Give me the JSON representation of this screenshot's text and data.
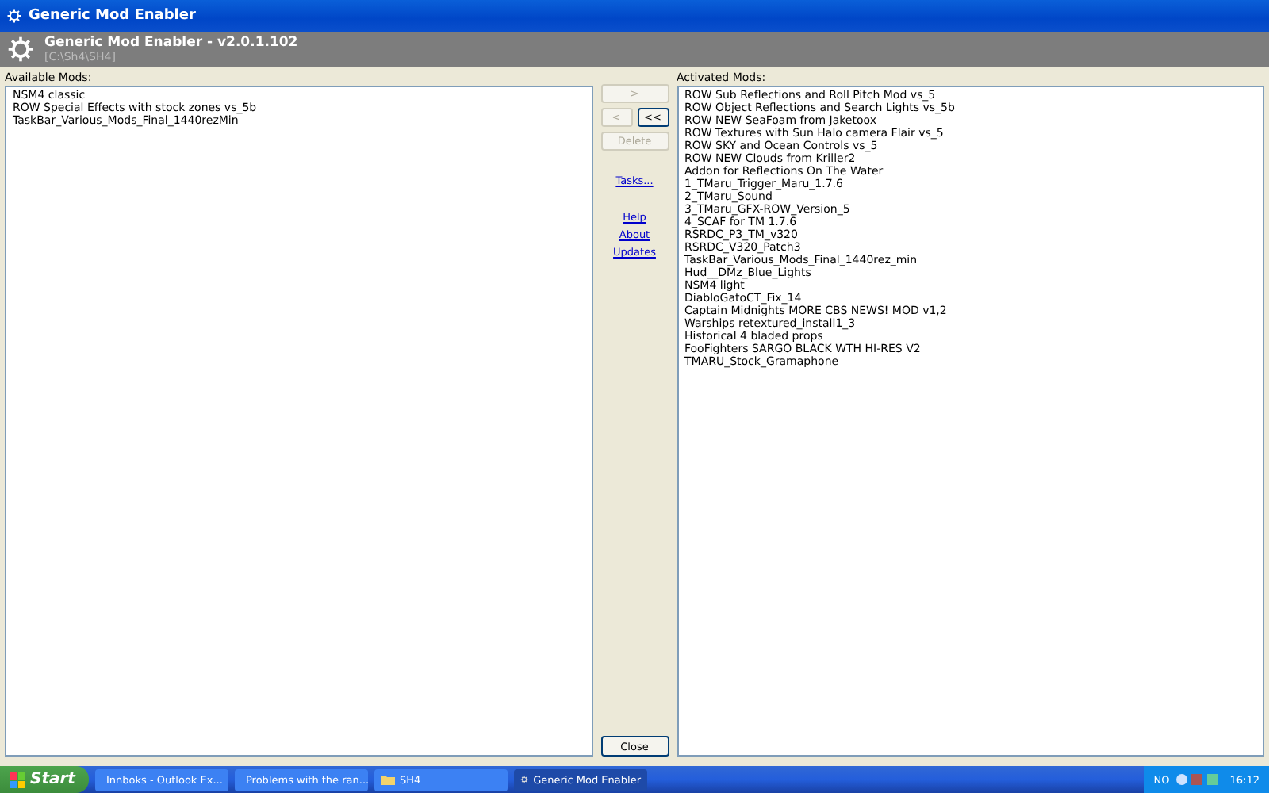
{
  "window": {
    "title": "Generic Mod Enabler"
  },
  "header": {
    "title": "Generic Mod Enabler - v2.0.1.102",
    "path": "[C:\\Sh4\\SH4]"
  },
  "available": {
    "label": "Available Mods:",
    "items": [
      {
        "text": "NSM4 classic",
        "selected": false
      },
      {
        "text": "ROW Special Effects with stock zones vs_5b",
        "selected": false
      },
      {
        "text": "TaskBar_Various_Mods_Final_1440rezMin",
        "selected": false
      }
    ]
  },
  "buttons": [
    {
      "label": ">",
      "disabled": true,
      "kind": "wide"
    },
    {
      "label": "<",
      "disabled": true,
      "kind": "half"
    },
    {
      "label": "<<",
      "disabled": false,
      "kind": "half"
    },
    {
      "label": "Delete",
      "disabled": true,
      "kind": "wide"
    }
  ],
  "links": [
    {
      "label": "Tasks...",
      "kind": "gap"
    },
    {
      "label": "Help",
      "kind": "gap"
    },
    {
      "label": "About",
      "kind": "plain"
    },
    {
      "label": "Updates",
      "kind": "plain"
    }
  ],
  "close_button": "Close",
  "activated": {
    "label": "Activated Mods:",
    "items": [
      {
        "text": "ROW Sub Reflections and Roll Pitch Mod vs_5",
        "selected": false
      },
      {
        "text": "ROW Object Reflections and Search Lights vs_5b",
        "selected": false
      },
      {
        "text": "ROW NEW SeaFoam from Jaketoox",
        "selected": false
      },
      {
        "text": "ROW Textures with Sun Halo camera Flair vs_5",
        "selected": false
      },
      {
        "text": "ROW SKY and Ocean Controls vs_5",
        "selected": false
      },
      {
        "text": "ROW NEW Clouds from Kriller2",
        "selected": false
      },
      {
        "text": "Addon for Reflections On The Water",
        "selected": false
      },
      {
        "text": "1_TMaru_Trigger_Maru_1.7.6",
        "selected": false
      },
      {
        "text": "2_TMaru_Sound",
        "selected": false
      },
      {
        "text": "3_TMaru_GFX-ROW_Version_5",
        "selected": false
      },
      {
        "text": "4_SCAF for TM 1.7.6",
        "selected": false
      },
      {
        "text": "RSRDC_P3_TM_v320",
        "selected": false
      },
      {
        "text": "RSRDC_V320_Patch3",
        "selected": false
      },
      {
        "text": "TaskBar_Various_Mods_Final_1440rez_min",
        "selected": false
      },
      {
        "text": "Hud__DMz_Blue_Lights",
        "selected": false
      },
      {
        "text": "NSM4 light",
        "selected": false
      },
      {
        "text": "DiabloGatoCT_Fix_14",
        "selected": false
      },
      {
        "text": "Captain Midnights MORE CBS NEWS! MOD v1,2",
        "selected": false
      },
      {
        "text": "Warships retextured_install1_3",
        "selected": false
      },
      {
        "text": "Historical 4 bladed props",
        "selected": false
      },
      {
        "text": "FooFighters SARGO BLACK WTH HI-RES V2",
        "selected": false
      },
      {
        "text": "TMARU_Stock_Gramaphone",
        "selected": false
      }
    ]
  },
  "taskbar": {
    "start": "Start",
    "tasks": [
      {
        "label": "Innboks - Outlook Ex...",
        "kind": "mail",
        "selected": false
      },
      {
        "label": "Problems with the ran...",
        "kind": "browser",
        "selected": false
      },
      {
        "label": "SH4",
        "kind": "folder",
        "selected": false
      },
      {
        "label": "Generic Mod Enabler",
        "kind": "gear",
        "selected": true
      }
    ],
    "language": "NO",
    "clock": "16:12"
  }
}
